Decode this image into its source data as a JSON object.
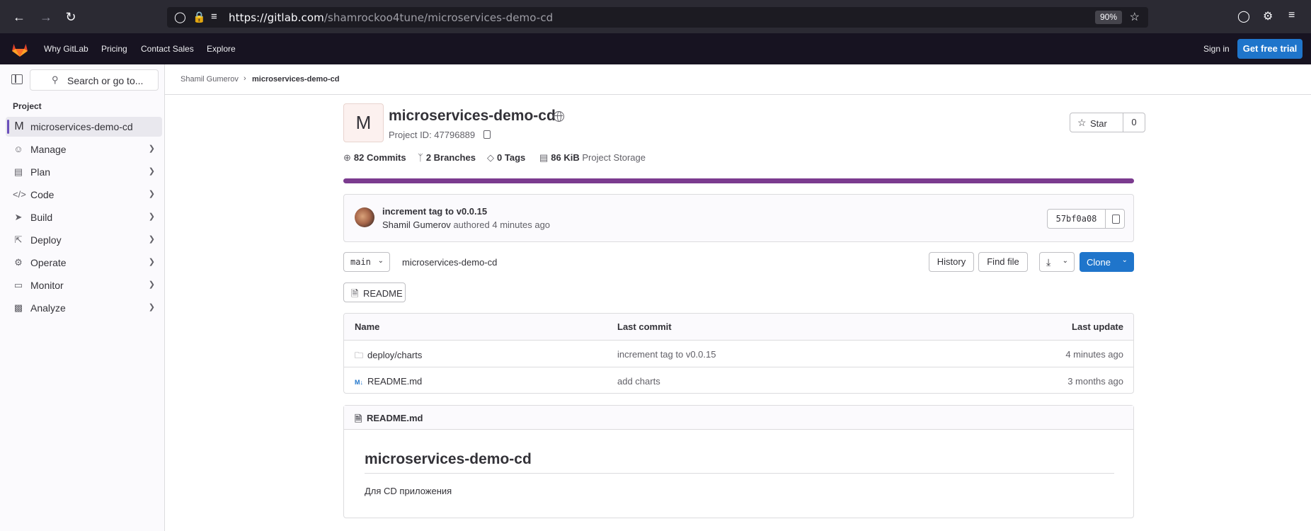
{
  "browser": {
    "url_host": "https://gitlab.com",
    "url_path": "/shamrockoo4tune/microservices-demo-cd",
    "zoom": "90%"
  },
  "topnav": {
    "links": [
      "Why GitLab",
      "Pricing",
      "Contact Sales",
      "Explore"
    ],
    "sign_in": "Sign in",
    "trial": "Get free trial"
  },
  "sidebar": {
    "search_placeholder": "Search or go to...",
    "section": "Project",
    "project_letter": "M",
    "items": [
      {
        "label": "microservices-demo-cd",
        "icon": "project-avatar"
      },
      {
        "label": "Manage",
        "icon": "users-icon"
      },
      {
        "label": "Plan",
        "icon": "calendar-icon"
      },
      {
        "label": "Code",
        "icon": "code-icon"
      },
      {
        "label": "Build",
        "icon": "rocket-icon"
      },
      {
        "label": "Deploy",
        "icon": "deploy-icon"
      },
      {
        "label": "Operate",
        "icon": "cloud-gear-icon"
      },
      {
        "label": "Monitor",
        "icon": "monitor-icon"
      },
      {
        "label": "Analyze",
        "icon": "chart-icon"
      }
    ]
  },
  "breadcrumb": {
    "owner": "Shamil Gumerov",
    "project": "microservices-demo-cd"
  },
  "project": {
    "avatar_letter": "M",
    "title": "microservices-demo-cd",
    "id_text": "Project ID: 47796889",
    "star_label": "Star",
    "star_count": "0",
    "stats": {
      "commits_count": "82",
      "commits_label": "Commits",
      "branches_count": "2",
      "branches_label": "Branches",
      "tags_count": "0",
      "tags_label": "Tags",
      "storage_size": "86 KiB",
      "storage_label": "Project Storage"
    }
  },
  "last_commit": {
    "title": "increment tag to v0.0.15",
    "author": "Shamil Gumerov",
    "action": "authored 4 minutes ago",
    "sha": "57bf0a08"
  },
  "repo_toolbar": {
    "branch": "main",
    "path": "microservices-demo-cd",
    "history": "History",
    "find_file": "Find file",
    "clone": "Clone",
    "readme_button": "README"
  },
  "file_table": {
    "headers": {
      "name": "Name",
      "last_commit": "Last commit",
      "last_update": "Last update"
    },
    "rows": [
      {
        "name": "deploy/charts",
        "type": "folder",
        "commit": "increment tag to v0.0.15",
        "updated": "4 minutes ago"
      },
      {
        "name": "README.md",
        "type": "markdown",
        "commit": "add charts",
        "updated": "3 months ago"
      }
    ]
  },
  "readme": {
    "filename": "README.md",
    "heading": "microservices-demo-cd",
    "body": "Для CD приложения"
  },
  "colors": {
    "primary": "#1f75cb",
    "topbar": "#171321",
    "progress": "#7b3b8f"
  }
}
